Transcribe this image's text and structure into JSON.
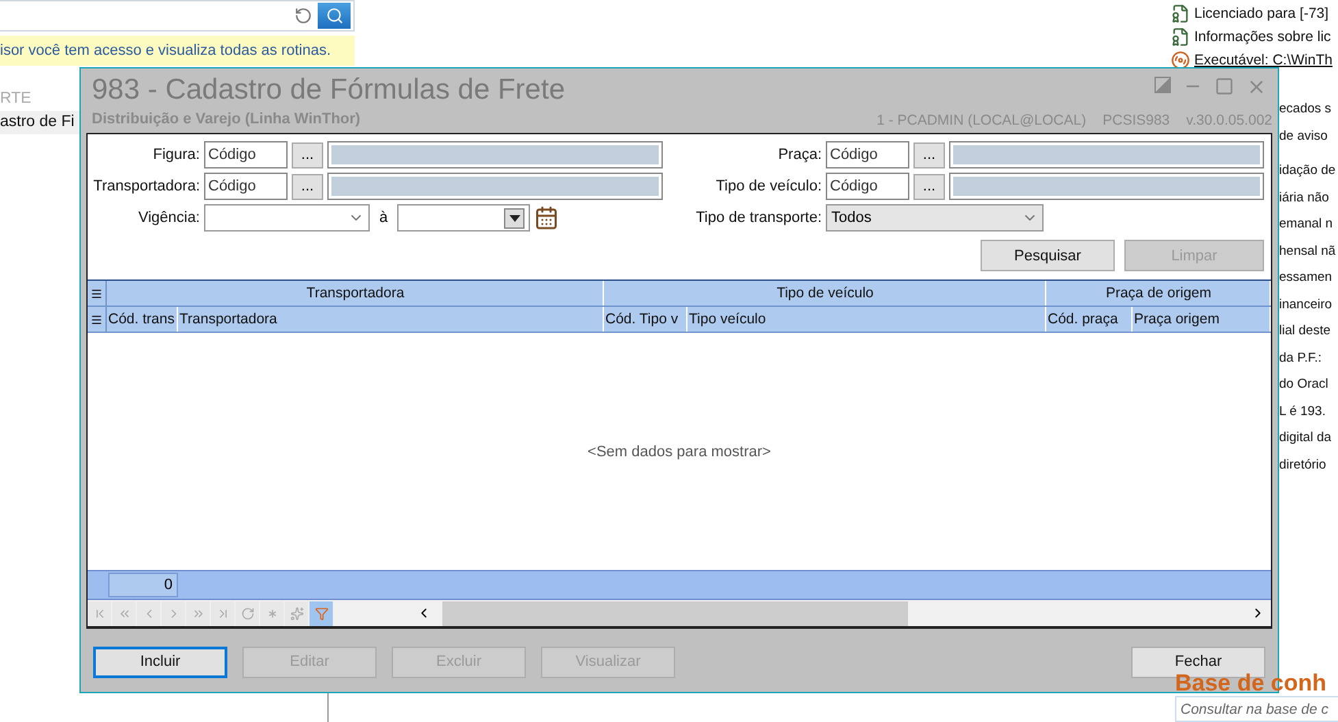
{
  "background": {
    "banner": "isor você tem acesso e visualiza todas as rotinas.",
    "sidebar": {
      "heading": "RTE",
      "items": [
        {
          "label": "astro de Fi",
          "selected": true
        }
      ]
    },
    "info_links": [
      {
        "kind": "certificate",
        "label": "Licenciado para [-73]"
      },
      {
        "kind": "certificate",
        "label": "Informações sobre lic"
      },
      {
        "kind": "program",
        "label": "Executável: C:\\WinTh"
      }
    ],
    "messages": [
      "ecados s",
      "de aviso",
      "idação de",
      "iária não",
      "emanal n",
      "hensal nã",
      "essamen",
      "inanceiro",
      "lial deste",
      "da P.F.:",
      "do Oracl",
      "L é 193.",
      "digital da",
      "diretório"
    ],
    "knowledge_base": {
      "title": "Base de conh",
      "placeholder": "Consultar na base de c"
    }
  },
  "dialog": {
    "title": "983 - Cadastro de Fórmulas de Frete",
    "subtitle": "Distribuição e Varejo (Linha WinThor)",
    "user": "1 - PCADMIN (LOCAL@LOCAL)",
    "program": "PCSIS983",
    "version": "v.30.0.05.002",
    "filters_left": [
      {
        "kind": "lookup",
        "label": "Figura:",
        "placeholder": "Código",
        "button": "..."
      },
      {
        "kind": "lookup",
        "label": "Transportadora:",
        "placeholder": "Código",
        "button": "..."
      },
      {
        "kind": "date_range",
        "label": "Vigência:",
        "separator": "à"
      }
    ],
    "filters_right": [
      {
        "kind": "lookup",
        "label": "Praça:",
        "placeholder": "Código",
        "button": "..."
      },
      {
        "kind": "lookup",
        "label": "Tipo de veículo:",
        "placeholder": "Código",
        "button": "..."
      },
      {
        "kind": "select",
        "label": "Tipo de transporte:",
        "value": "Todos"
      }
    ],
    "search_buttons": [
      {
        "label": "Pesquisar",
        "disabled": false
      },
      {
        "label": "Limpar",
        "disabled": true
      }
    ],
    "grid": {
      "bands": [
        {
          "label": "Transportadora",
          "columns": [
            "Cód. trans",
            "Transportadora"
          ]
        },
        {
          "label": "Tipo de veículo",
          "columns": [
            "Cód. Tipo v",
            "Tipo veículo"
          ]
        },
        {
          "label": "Praça de origem",
          "columns": [
            "Cód. praça",
            "Praça origem"
          ]
        }
      ],
      "empty_text": "<Sem dados para mostrar>",
      "count": "0",
      "filter_active": true
    },
    "actions": [
      {
        "label": "Incluir",
        "disabled": false,
        "focused": true
      },
      {
        "label": "Editar",
        "disabled": true,
        "focused": false
      },
      {
        "label": "Excluir",
        "disabled": true,
        "focused": false
      },
      {
        "label": "Visualizar",
        "disabled": true,
        "focused": false
      }
    ],
    "close_button": "Fechar"
  }
}
